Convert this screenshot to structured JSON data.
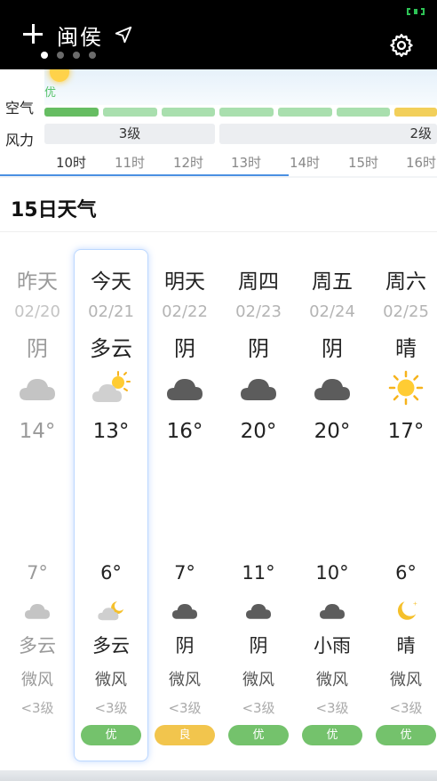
{
  "header": {
    "city": "闽侯",
    "page_dots": 4,
    "active_dot": 0
  },
  "hourly": {
    "aqi_top_label": "优",
    "labels": {
      "air": "空气",
      "wind": "风力"
    },
    "wind_segments": [
      {
        "label": "3级"
      },
      {
        "label": "2级"
      }
    ],
    "hours": [
      "10时",
      "11时",
      "12时",
      "13时",
      "14时",
      "15时",
      "16时"
    ],
    "aqi_levels": [
      "优",
      "优",
      "优",
      "优",
      "优",
      "优",
      "良"
    ]
  },
  "daily": {
    "title": "15日天气",
    "days": [
      {
        "name": "昨天",
        "date": "02/20",
        "day_cond": "阴",
        "day_icon": "cloud-icon",
        "high": "14°",
        "low": "7°",
        "night_icon": "cloud-icon",
        "night_cond": "多云",
        "wind": "微风",
        "wind_level": "<3级",
        "aqi": "",
        "high_value": 14,
        "low_value": 7,
        "past": true
      },
      {
        "name": "今天",
        "date": "02/21",
        "day_cond": "多云",
        "day_icon": "partly-cloudy-icon",
        "high": "13°",
        "low": "6°",
        "night_icon": "partly-cloudy-night-icon",
        "night_cond": "多云",
        "wind": "微风",
        "wind_level": "<3级",
        "aqi": "优",
        "high_value": 13,
        "low_value": 6
      },
      {
        "name": "明天",
        "date": "02/22",
        "day_cond": "阴",
        "day_icon": "cloud-icon",
        "high": "16°",
        "low": "7°",
        "night_icon": "cloud-icon",
        "night_cond": "阴",
        "wind": "微风",
        "wind_level": "<3级",
        "aqi": "良",
        "high_value": 16,
        "low_value": 7
      },
      {
        "name": "周四",
        "date": "02/23",
        "day_cond": "阴",
        "day_icon": "cloud-icon",
        "high": "20°",
        "low": "11°",
        "night_icon": "cloud-icon",
        "night_cond": "阴",
        "wind": "微风",
        "wind_level": "<3级",
        "aqi": "优",
        "high_value": 20,
        "low_value": 11
      },
      {
        "name": "周五",
        "date": "02/24",
        "day_cond": "阴",
        "day_icon": "cloud-icon",
        "high": "20°",
        "low": "10°",
        "night_icon": "cloud-icon",
        "night_cond": "小雨",
        "wind": "微风",
        "wind_level": "<3级",
        "aqi": "优",
        "high_value": 20,
        "low_value": 10
      },
      {
        "name": "周六",
        "date": "02/25",
        "day_cond": "晴",
        "day_icon": "sun-icon",
        "high": "17°",
        "low": "6°",
        "night_icon": "moon-icon",
        "night_cond": "晴",
        "wind": "微风",
        "wind_level": "<3级",
        "aqi": "优",
        "high_value": 17,
        "low_value": 6
      }
    ]
  },
  "colors": {
    "high_line": "#e77a9b",
    "low_line": "#6fb2ea",
    "aqi_good": "#74c26c",
    "aqi_moderate": "#f2c54d",
    "accent": "#4a90e2"
  }
}
